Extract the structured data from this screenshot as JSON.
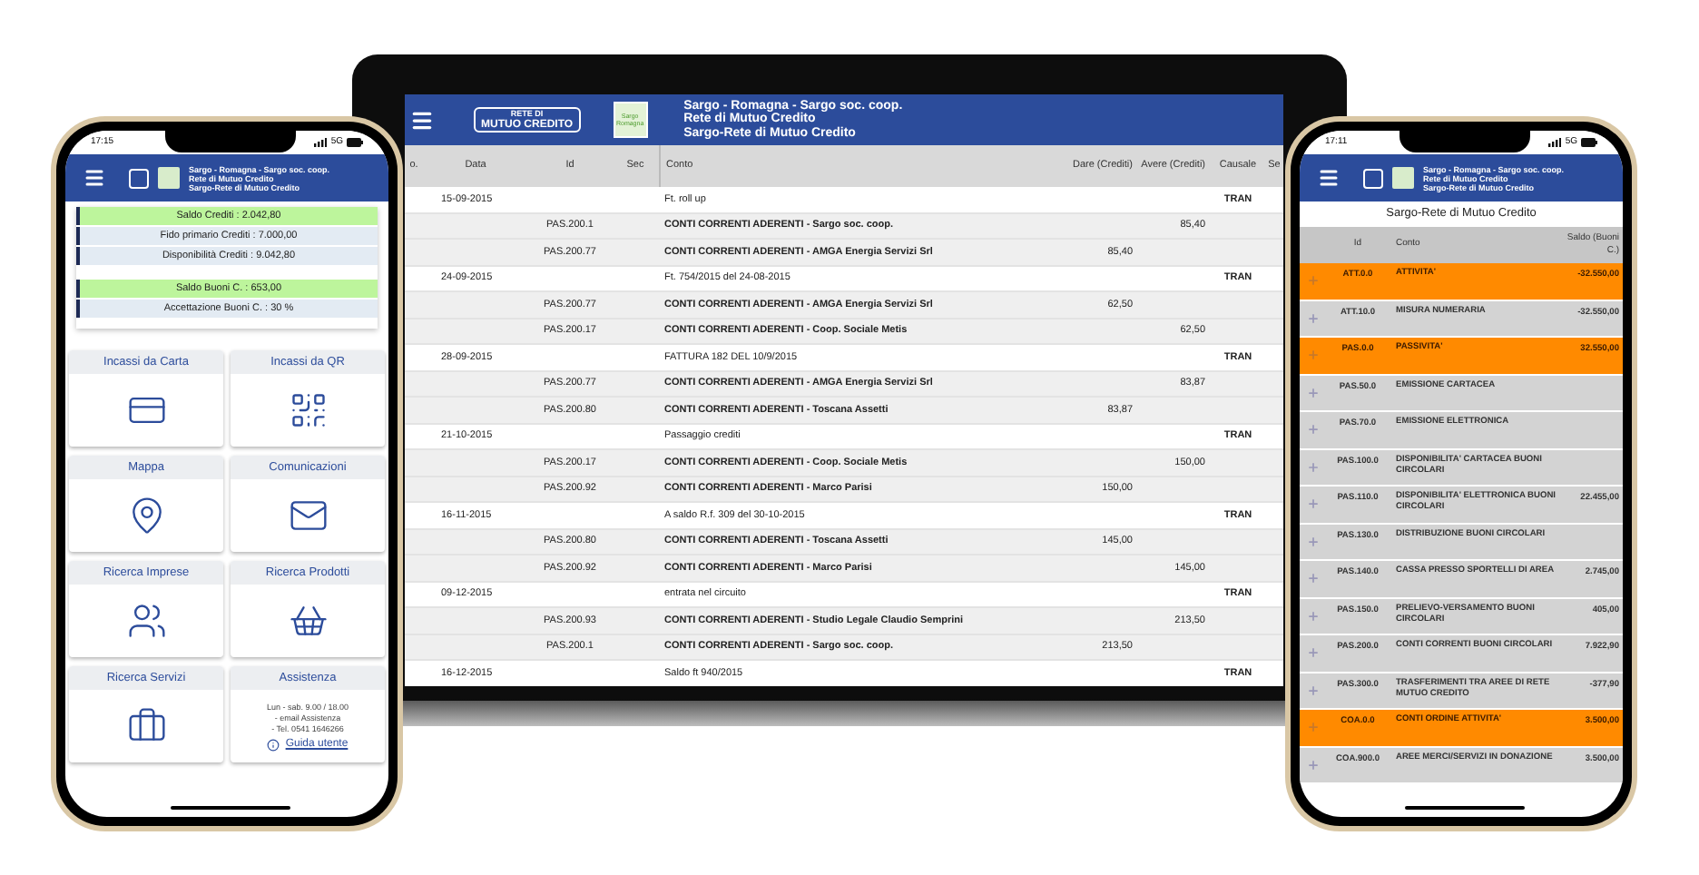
{
  "laptop": {
    "header": {
      "logo_lines": [
        "RETE DI",
        "MUTUO CREDITO"
      ],
      "badge_lines": [
        "Sargo",
        "Romagna"
      ],
      "title_lines": [
        "Sargo - Romagna - Sargo soc. coop.",
        "Rete di Mutuo Credito",
        "Sargo-Rete di Mutuo Credito"
      ]
    },
    "table": {
      "columns": [
        "o.",
        "Data",
        "Id",
        "Sec",
        "Conto",
        "Dare (Crediti)",
        "Avere (Crediti)",
        "Causale",
        "Se"
      ],
      "rows": [
        {
          "kind": "entry",
          "data": "15-09-2015",
          "conto": "Ft. roll up",
          "causale": "TRAN"
        },
        {
          "kind": "line",
          "id": "PAS.200.1",
          "conto": "CONTI CORRENTI ADERENTI - Sargo soc. coop.",
          "avere": "85,40"
        },
        {
          "kind": "line",
          "id": "PAS.200.77",
          "conto": "CONTI CORRENTI ADERENTI - AMGA Energia Servizi Srl",
          "dare": "85,40"
        },
        {
          "kind": "entry",
          "data": "24-09-2015",
          "conto": "Ft. 754/2015 del 24-08-2015",
          "causale": "TRAN"
        },
        {
          "kind": "line",
          "id": "PAS.200.77",
          "conto": "CONTI CORRENTI ADERENTI - AMGA Energia Servizi Srl",
          "dare": "62,50"
        },
        {
          "kind": "line",
          "id": "PAS.200.17",
          "conto": "CONTI CORRENTI ADERENTI - Coop. Sociale Metis",
          "avere": "62,50"
        },
        {
          "kind": "entry",
          "data": "28-09-2015",
          "conto": "FATTURA 182 DEL 10/9/2015",
          "causale": "TRAN"
        },
        {
          "kind": "line",
          "id": "PAS.200.77",
          "conto": "CONTI CORRENTI ADERENTI - AMGA Energia Servizi Srl",
          "avere": "83,87"
        },
        {
          "kind": "line",
          "id": "PAS.200.80",
          "conto": "CONTI CORRENTI ADERENTI - Toscana Assetti",
          "dare": "83,87"
        },
        {
          "kind": "entry",
          "data": "21-10-2015",
          "conto": "Passaggio crediti",
          "causale": "TRAN"
        },
        {
          "kind": "line",
          "id": "PAS.200.17",
          "conto": "CONTI CORRENTI ADERENTI - Coop. Sociale Metis",
          "avere": "150,00"
        },
        {
          "kind": "line",
          "id": "PAS.200.92",
          "conto": "CONTI CORRENTI ADERENTI - Marco Parisi",
          "dare": "150,00"
        },
        {
          "kind": "entry",
          "data": "16-11-2015",
          "conto": "A saldo R.f. 309 del 30-10-2015",
          "causale": "TRAN"
        },
        {
          "kind": "line",
          "id": "PAS.200.80",
          "conto": "CONTI CORRENTI ADERENTI - Toscana Assetti",
          "dare": "145,00"
        },
        {
          "kind": "line",
          "id": "PAS.200.92",
          "conto": "CONTI CORRENTI ADERENTI - Marco Parisi",
          "avere": "145,00"
        },
        {
          "kind": "entry",
          "data": "09-12-2015",
          "conto": "entrata nel circuito",
          "causale": "TRAN"
        },
        {
          "kind": "line",
          "id": "PAS.200.93",
          "conto": "CONTI CORRENTI ADERENTI - Studio Legale Claudio Semprini",
          "avere": "213,50"
        },
        {
          "kind": "line",
          "id": "PAS.200.1",
          "conto": "CONTI CORRENTI ADERENTI - Sargo soc. coop.",
          "dare": "213,50"
        },
        {
          "kind": "entry",
          "data": "16-12-2015",
          "conto": "Saldo ft 940/2015",
          "causale": "TRAN"
        }
      ]
    }
  },
  "left_phone": {
    "status": {
      "time": "17:15",
      "network": "5G"
    },
    "header": {
      "title_lines": [
        "Sargo - Romagna - Sargo soc. coop.",
        "Rete di Mutuo Credito",
        "Sargo-Rete di Mutuo Credito"
      ]
    },
    "balance_groups": [
      {
        "rows": [
          {
            "text": "Saldo Crediti : 2.042,80",
            "highlighted": true
          },
          {
            "text": "Fido primario Crediti : 7.000,00",
            "highlighted": false
          },
          {
            "text": "Disponibilità Crediti : 9.042,80",
            "highlighted": false
          }
        ]
      },
      {
        "rows": [
          {
            "text": "Saldo Buoni C. : 653,00",
            "highlighted": true
          },
          {
            "text": "Accettazione Buoni C. : 30 %",
            "highlighted": false
          }
        ]
      }
    ],
    "tiles": [
      {
        "kind": "icon",
        "label": "Incassi da Carta"
      },
      {
        "kind": "icon",
        "label": "Incassi da QR"
      },
      {
        "kind": "icon",
        "label": "Mappa"
      },
      {
        "kind": "icon",
        "label": "Comunicazioni"
      },
      {
        "kind": "icon",
        "label": "Ricerca Imprese"
      },
      {
        "kind": "icon",
        "label": "Ricerca Prodotti"
      },
      {
        "kind": "icon",
        "label": "Ricerca Servizi"
      },
      {
        "kind": "contact",
        "label": "Assistenza",
        "lines": [
          "Lun - sab. 9.00 / 18.00",
          "- email Assistenza",
          "- Tel. 0541 1646266"
        ],
        "link": "Guida utente"
      }
    ]
  },
  "right_phone": {
    "status": {
      "time": "17:11",
      "network": "5G"
    },
    "header": {
      "title_lines": [
        "Sargo - Romagna - Sargo soc. coop.",
        "Rete di Mutuo Credito",
        "Sargo-Rete di Mutuo Credito"
      ]
    },
    "subtitle": "Sargo-Rete di Mutuo Credito",
    "columns": [
      "Id",
      "Conto",
      "Saldo (Buoni C.)"
    ],
    "rows": [
      {
        "id": "ATT.0.0",
        "conto": "ATTIVITA'",
        "saldo": "-32.550,00",
        "highlighted": true
      },
      {
        "id": "ATT.10.0",
        "conto": "MISURA NUMERARIA",
        "saldo": "-32.550,00",
        "highlighted": false
      },
      {
        "id": "PAS.0.0",
        "conto": "PASSIVITA'",
        "saldo": "32.550,00",
        "highlighted": true
      },
      {
        "id": "PAS.50.0",
        "conto": "EMISSIONE CARTACEA",
        "highlighted": false
      },
      {
        "id": "PAS.70.0",
        "conto": "EMISSIONE ELETTRONICA",
        "highlighted": false
      },
      {
        "id": "PAS.100.0",
        "conto": "DISPONIBILITA' CARTACEA BUONI CIRCOLARI",
        "highlighted": false
      },
      {
        "id": "PAS.110.0",
        "conto": "DISPONIBILITA' ELETTRONICA BUONI CIRCOLARI",
        "saldo": "22.455,00",
        "highlighted": false
      },
      {
        "id": "PAS.130.0",
        "conto": "DISTRIBUZIONE BUONI CIRCOLARI",
        "highlighted": false
      },
      {
        "id": "PAS.140.0",
        "conto": "CASSA PRESSO SPORTELLI DI AREA",
        "saldo": "2.745,00",
        "highlighted": false
      },
      {
        "id": "PAS.150.0",
        "conto": "PRELIEVO-VERSAMENTO BUONI CIRCOLARI",
        "saldo": "405,00",
        "highlighted": false
      },
      {
        "id": "PAS.200.0",
        "conto": "CONTI CORRENTI BUONI CIRCOLARI",
        "saldo": "7.922,90",
        "highlighted": false
      },
      {
        "id": "PAS.300.0",
        "conto": "TRASFERIMENTI TRA AREE DI RETE MUTUO CREDITO",
        "saldo": "-377,90",
        "highlighted": false
      },
      {
        "id": "COA.0.0",
        "conto": "CONTI ORDINE ATTIVITA'",
        "saldo": "3.500,00",
        "highlighted": true
      },
      {
        "id": "COA.900.0",
        "conto": "AREE MERCI/SERVIZI IN DONAZIONE",
        "saldo": "3.500,00",
        "highlighted": false
      }
    ]
  }
}
